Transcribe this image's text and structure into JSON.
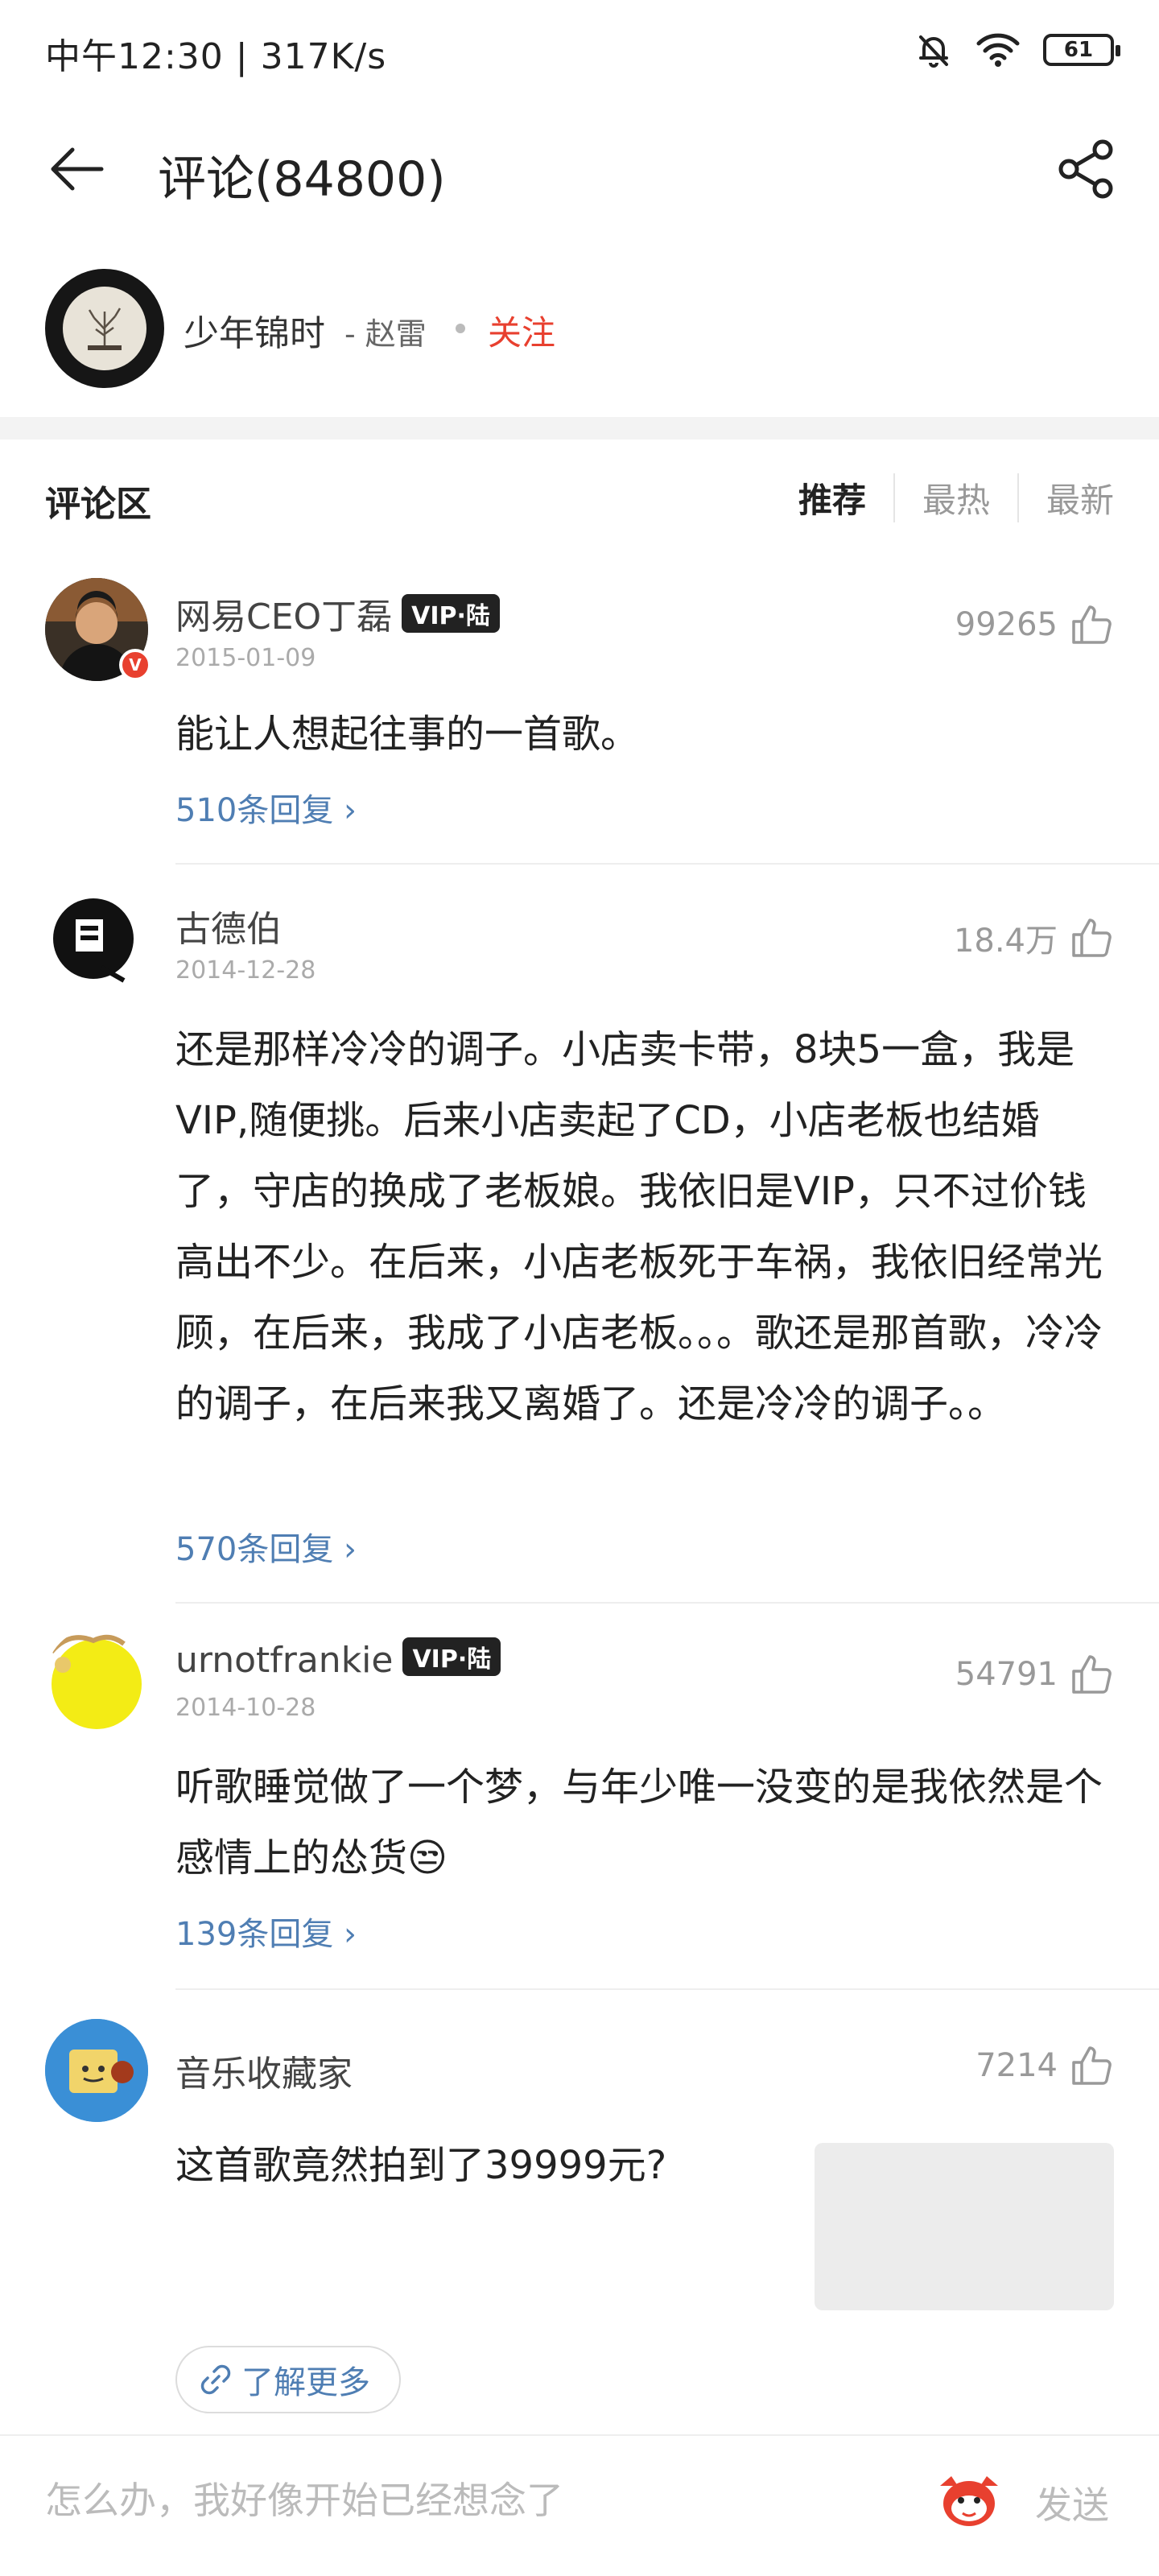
{
  "status_bar": {
    "time_speed": "中午12:30 | 317K/s",
    "battery": "61"
  },
  "header": {
    "title": "评论(84800)"
  },
  "song": {
    "title": "少年锦时",
    "artist": "- 赵雷",
    "follow": "关注"
  },
  "comments_header": {
    "title": "评论区",
    "sort_tabs": [
      "推荐",
      "最热",
      "最新"
    ],
    "active_tab": "推荐"
  },
  "comments": [
    {
      "user": "网易CEO丁磊",
      "vip": "VIP·陆",
      "verified_mark": "V",
      "date": "2015-01-09",
      "likes": "99265",
      "text": "能让人想起往事的一首歌。",
      "replies": "510条回复 ›"
    },
    {
      "user": "古德伯",
      "date": "2014-12-28",
      "likes": "18.4万",
      "text": "还是那样冷冷的调子。小店卖卡带，8块5一盒，我是VIP,随便挑。后来小店卖起了CD，小店老板也结婚了，守店的换成了老板娘。我依旧是VIP，只不过价钱高出不少。在后来，小店老板死于车祸，我依旧经常光顾，在后来，我成了小店老板。。。歌还是那首歌，冷冷的调子，在后来我又离婚了。还是冷冷的调子。。",
      "replies": "570条回复 ›"
    },
    {
      "user": "urnotfrankie",
      "vip": "VIP·陆",
      "date": "2014-10-28",
      "likes": "54791",
      "text": "听歌睡觉做了一个梦，与年少唯一没变的是我依然是个感情上的怂货😒",
      "replies": "139条回复 ›"
    },
    {
      "user": "音乐收藏家",
      "likes": "7214",
      "text": "这首歌竟然拍到了39999元?",
      "learn_more": "了解更多"
    }
  ],
  "input_bar": {
    "placeholder": "怎么办，我好像开始已经想念了",
    "send": "发送"
  },
  "colors": {
    "accent_red": "#e8402f",
    "link_blue": "#4f7eb3"
  }
}
